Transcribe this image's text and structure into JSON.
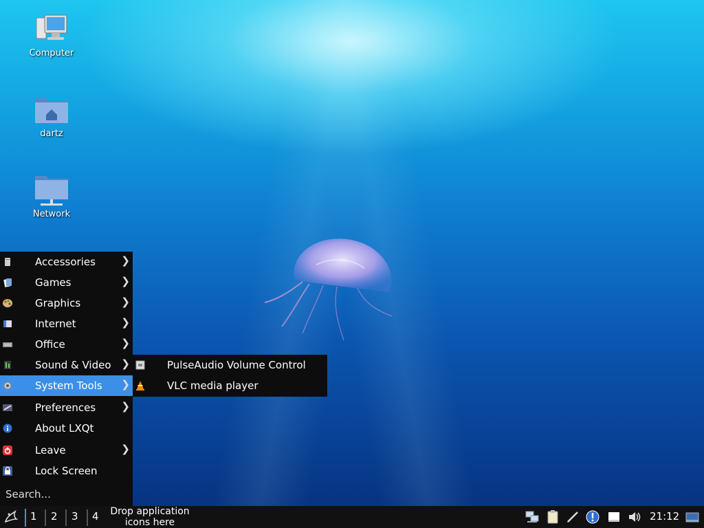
{
  "desktop": {
    "icons": [
      {
        "label": "Computer",
        "icon": "computer-icon"
      },
      {
        "label": "dartz",
        "icon": "home-folder-icon"
      },
      {
        "label": "Network",
        "icon": "network-folder-icon"
      }
    ]
  },
  "menu": {
    "items": [
      {
        "label": "Accessories",
        "icon": "accessories-icon",
        "submenu": true
      },
      {
        "label": "Games",
        "icon": "games-icon",
        "submenu": true
      },
      {
        "label": "Graphics",
        "icon": "graphics-icon",
        "submenu": true
      },
      {
        "label": "Internet",
        "icon": "internet-icon",
        "submenu": true
      },
      {
        "label": "Office",
        "icon": "office-icon",
        "submenu": true
      },
      {
        "label": "Sound & Video",
        "icon": "sound-video-icon",
        "submenu": true
      },
      {
        "label": "System Tools",
        "icon": "gear-icon",
        "submenu": true,
        "active": true
      },
      {
        "label": "Preferences",
        "icon": "preferences-icon",
        "submenu": true
      },
      {
        "label": "About LXQt",
        "icon": "info-icon",
        "submenu": false
      },
      {
        "label": "Leave",
        "icon": "power-icon",
        "submenu": true
      },
      {
        "label": "Lock Screen",
        "icon": "lock-icon",
        "submenu": false
      }
    ],
    "search_placeholder": "Search...",
    "arrow_glyph": "❯"
  },
  "submenu": {
    "items": [
      {
        "label": "PulseAudio Volume Control",
        "icon": "pulseaudio-icon"
      },
      {
        "label": "VLC media player",
        "icon": "vlc-cone-icon"
      }
    ]
  },
  "taskbar": {
    "workspaces": [
      "1",
      "2",
      "3",
      "4"
    ],
    "active_workspace": "1",
    "quicklaunch_text": "Drop application icons here",
    "clock": "21:12",
    "tray_icons": [
      "network-icon",
      "clipboard-icon",
      "pen-icon",
      "update-notification-icon",
      "removable-drive-icon",
      "volume-icon",
      "show-desktop-icon"
    ]
  },
  "colors": {
    "menu_bg": "#0d0d0d",
    "menu_highlight": "#3c8fe8",
    "taskbar_bg": "#111111"
  }
}
